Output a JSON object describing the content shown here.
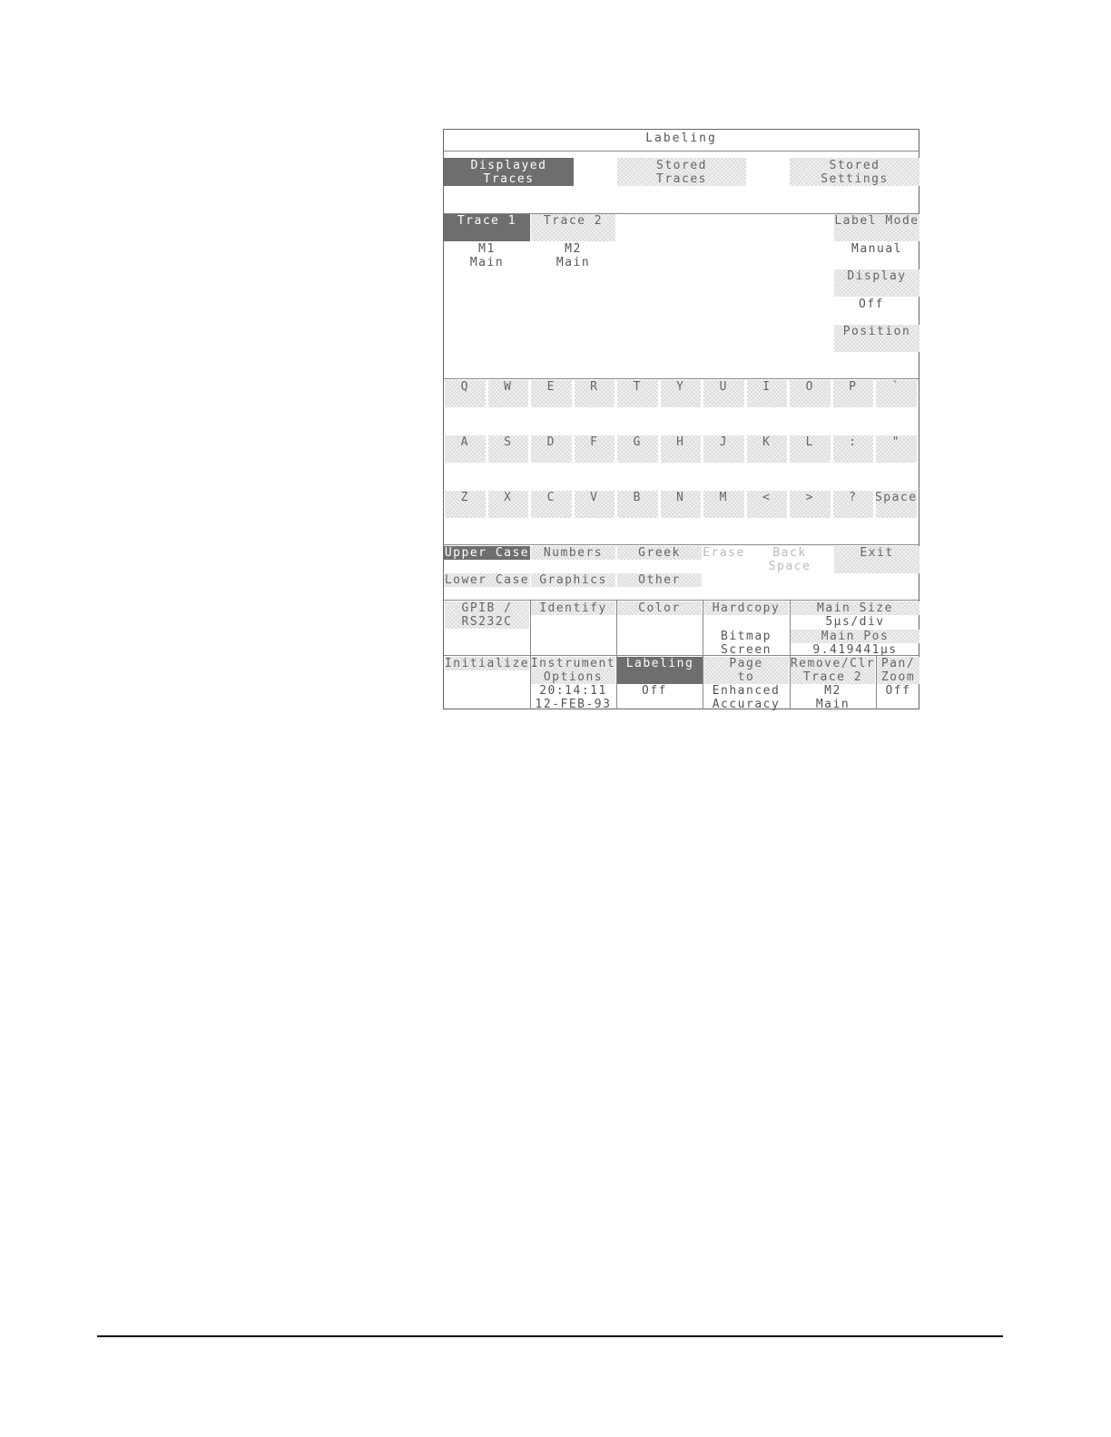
{
  "title": "Labeling",
  "source_tabs": [
    {
      "line1": "Displayed",
      "line2": "Traces",
      "selected": true
    },
    {
      "line1": "Stored",
      "line2": "Traces",
      "selected": false
    },
    {
      "line1": "Stored",
      "line2": "Settings",
      "selected": false
    }
  ],
  "traces": [
    {
      "label": "Trace 1",
      "source": "M1",
      "timebase": "Main",
      "selected": true
    },
    {
      "label": "Trace 2",
      "source": "M2",
      "timebase": "Main",
      "selected": false
    }
  ],
  "right_menu": {
    "label_mode": {
      "label": "Label Mode",
      "value": "Manual"
    },
    "display": {
      "label": "Display",
      "value": "Off"
    },
    "position": {
      "label": "Position"
    }
  },
  "keyboard": {
    "row1": [
      "Q",
      "W",
      "E",
      "R",
      "T",
      "Y",
      "U",
      "I",
      "O",
      "P",
      "`"
    ],
    "row2": [
      "A",
      "S",
      "D",
      "F",
      "G",
      "H",
      "J",
      "K",
      "L",
      ":",
      "\""
    ],
    "row3": [
      "Z",
      "X",
      "C",
      "V",
      "B",
      "N",
      "M",
      "<",
      ">",
      "?",
      "Space"
    ]
  },
  "char_sets": {
    "upper_case": "Upper Case",
    "lower_case": "Lower Case",
    "numbers": "Numbers",
    "graphics": "Graphics",
    "greek": "Greek",
    "other": "Other",
    "erase": "Erase",
    "back_space_1": "Back",
    "back_space_2": "Space",
    "exit": "Exit"
  },
  "bottom_row1": {
    "gpib_1": "GPIB /",
    "gpib_2": "RS232C",
    "identify": "Identify",
    "color": "Color",
    "hardcopy": "Hardcopy",
    "hardcopy_v1": "Bitmap",
    "hardcopy_v2": "Screen",
    "main_size_label": "Main Size",
    "main_size_value": "5μs/div",
    "main_pos_label": "Main Pos",
    "main_pos_value": "9.419441μs"
  },
  "bottom_row2": {
    "initialize": "Initialize",
    "instr_1": "Instrument",
    "instr_2": "Options",
    "instr_time": "20:14:11",
    "instr_date": "12-FEB-93",
    "labeling": "Labeling",
    "labeling_value": "Off",
    "page_1": "Page",
    "page_2": "to",
    "page_v1": "Enhanced",
    "page_v2": "Accuracy",
    "remove_1": "Remove/Clr",
    "remove_2": "Trace 2",
    "remove_v1": "M2",
    "remove_v2": "Main",
    "pan_1": "Pan/",
    "pan_2": "Zoom",
    "pan_value": "Off"
  }
}
